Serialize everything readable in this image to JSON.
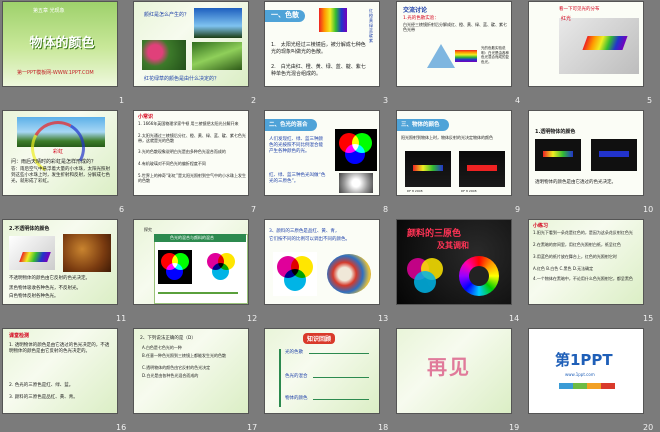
{
  "slides": [
    {
      "num": "1",
      "title": "物体的颜色",
      "sub1": "第五章 光现象",
      "sub2": "第一PPT模板网-WWW.1PPT.COM"
    },
    {
      "num": "2",
      "question": "颜红是怎么产生的？",
      "caption": "红花绿草的颜色是由什么决定的？"
    },
    {
      "num": "3",
      "head": "一、色散",
      "side": "红橙黄绿蓝靛紫",
      "p1": "1.　太阳光经过三棱镜后，被分解成七种色光的现象叫做光的色散。",
      "p2": "2.　白光由红、橙、黄、绿、蓝、靛、紫七种单色光混合组成的。"
    },
    {
      "num": "4",
      "head": "交流讨论",
      "p1": "1.光的色散实验：",
      "p2": "白光经三棱镜折射后分解成红、橙、黄、绿、蓝、靛、紫七色光带",
      "p3": "光的色散实验说明：白光是由各种色光混合而成的复色光。"
    },
    {
      "num": "5",
      "label": "红光",
      "note": "看一下可见光的分布"
    },
    {
      "num": "6",
      "label": "彩虹",
      "p1": "问：雨后天晴时的彩虹是怎样形成的？",
      "p2": "答：雨后空气中悬浮着大量的小水珠，太阳光照射到这些小水珠上时，发生折射和反射，分解成七色光，就形成了彩虹。"
    },
    {
      "num": "7",
      "head": "小常识",
      "p1": "1. 1666年英国物理学家牛顿 用三棱镜把太阳光分解开来",
      "p2": "2.太阳光通过三棱镜后分红、橙、黄、绿、蓝、靛、紫七色光带，这就是光的色散",
      "p3": "3.光的色散现象说明白光是由多种色光混合而成的",
      "p4": "4.有机玻璃对不同色光的偏折程度不同",
      "p5": "5.世界上的神奇“彩虹”是太阳光照射到空气中的小水珠上发生的色散"
    },
    {
      "num": "8",
      "head": "二、色光的混合",
      "p1": "人们发现红、绿、蓝三种颜色的光按照不同比例混合能产生各种颜色的光。",
      "p2": "红、绿、蓝三种色光叫做“色光的三原色”。"
    },
    {
      "num": "9",
      "head": "三、物体的颜色",
      "p1": "阳光照射到物体上时，物体反射的光决定物体的颜色",
      "p2": "DF 8 2008",
      "p3": "DF 8 2008"
    },
    {
      "num": "10",
      "p1": "1.透明物体的颜色",
      "p2": "透明物体的颜色是由它透过的色光决定。"
    },
    {
      "num": "11",
      "p1": "2.不透明体的颜色",
      "p2": "不透明物体的颜色由它反射的色光决定。",
      "p3": "黑色物体吸收各种色光，不反射光。",
      "p4": "白色物体反射各种色光。"
    },
    {
      "num": "12",
      "p1": "探究",
      "p2": "色光的混合与颜料的混合"
    },
    {
      "num": "13",
      "p1": "3、颜料的三原色是品红、黄、青，",
      "p2": "它们按不同的比例可以调出不同的颜色。"
    },
    {
      "num": "14",
      "p1": "颜料的三原色",
      "p2": "及其调和"
    },
    {
      "num": "15",
      "p1": "小练习",
      "p2": "1.阳光下看到一朵花是红色的，是因为这朵花反射红色光",
      "p3": "2.在黑暗的房间里，用红色光照射白纸，纸呈红色",
      "p4": "3.用蓝色的纸片放在舞台上，红色的光照射它时",
      "p5": "A.红色  B.白色  C.黑色  D.无法确定",
      "p6": "4.一个物体在黑暗中，不论用什么色光照射它，都呈黑色"
    },
    {
      "num": "16",
      "p1": "课堂检测",
      "p2": "1. 透明物体的颜色是由它透过的色光决定的，不透明物体的颜色是由它反射的色光决定的。",
      "p3": "2. 色光的三原色是红、绿、蓝。",
      "p4": "3. 颜料的三原色是品红、黄、青。"
    },
    {
      "num": "17",
      "p1": "2、下列说法正确的是（D）",
      "p2": "A.白色是七色光的一种",
      "p3": "B.任意一种色光照到三棱镜上都能发生光的色散",
      "p4": "C.透明物体的颜色由它反射的色光决定",
      "p5": "D.白光是由各种色光混合而成的"
    },
    {
      "num": "18",
      "p1": "知识回顾",
      "p2": "光的色散",
      "p3": "色光的混合",
      "p4": "物体的颜色"
    },
    {
      "num": "19",
      "p1": "再见"
    },
    {
      "num": "20",
      "p1": "第1PPT",
      "p2": "www.1ppt.com"
    }
  ]
}
